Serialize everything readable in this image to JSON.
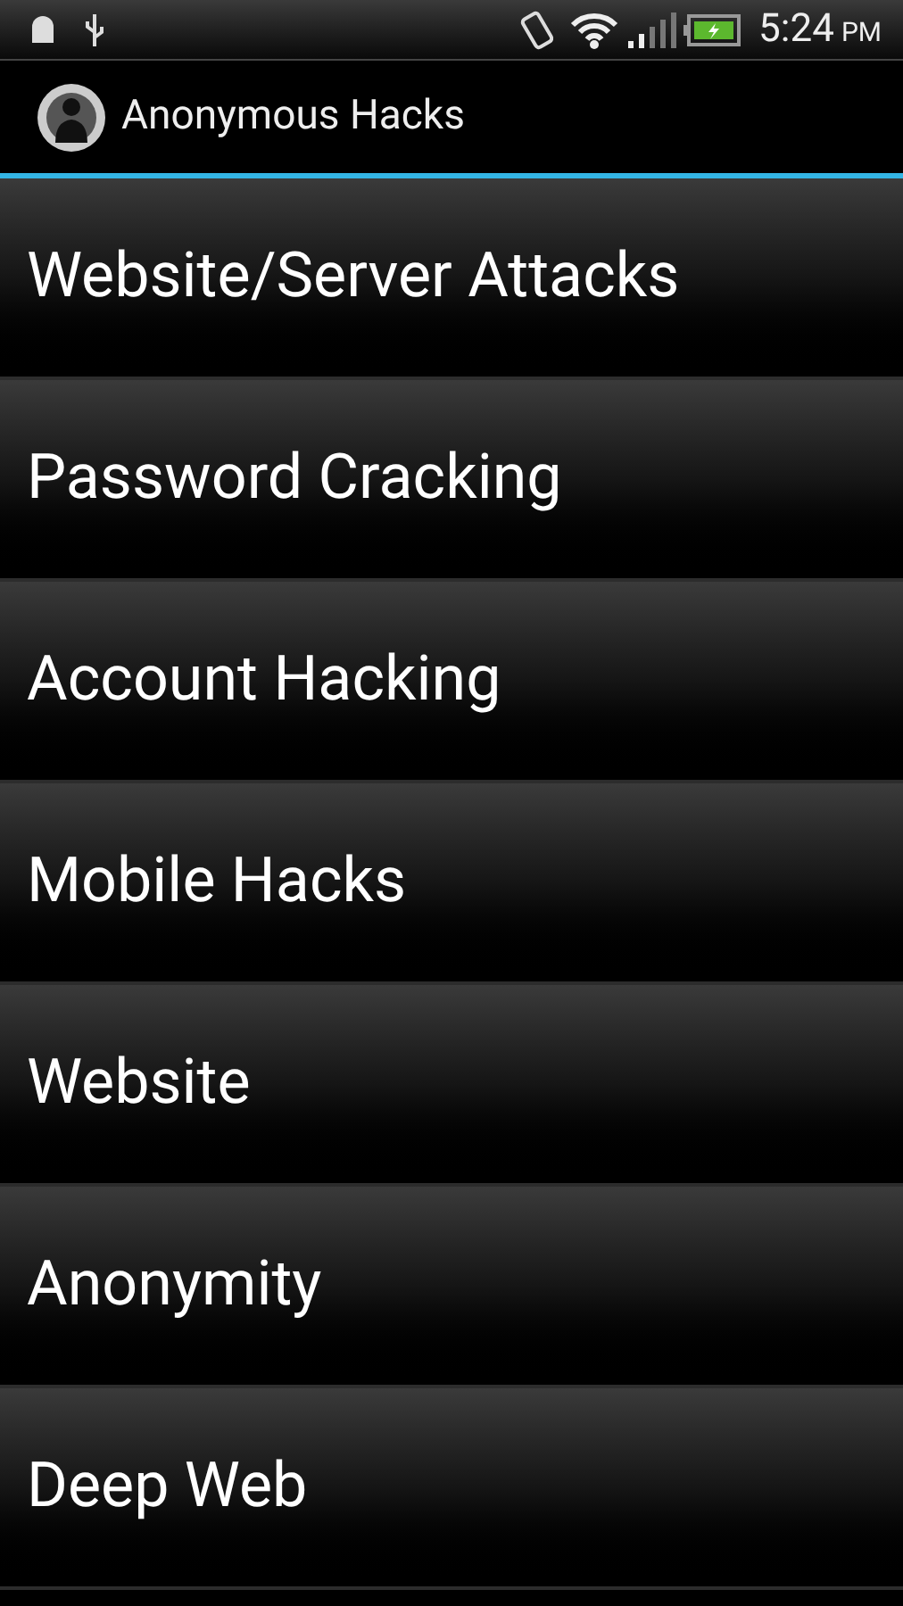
{
  "status_bar": {
    "time": "5:24",
    "meridiem": "PM"
  },
  "action_bar": {
    "title": "Anonymous Hacks"
  },
  "menu_items": [
    {
      "label": "Website/Server Attacks"
    },
    {
      "label": "Password Cracking"
    },
    {
      "label": "Account Hacking"
    },
    {
      "label": "Mobile Hacks"
    },
    {
      "label": "Website"
    },
    {
      "label": "Anonymity"
    },
    {
      "label": "Deep Web"
    }
  ]
}
